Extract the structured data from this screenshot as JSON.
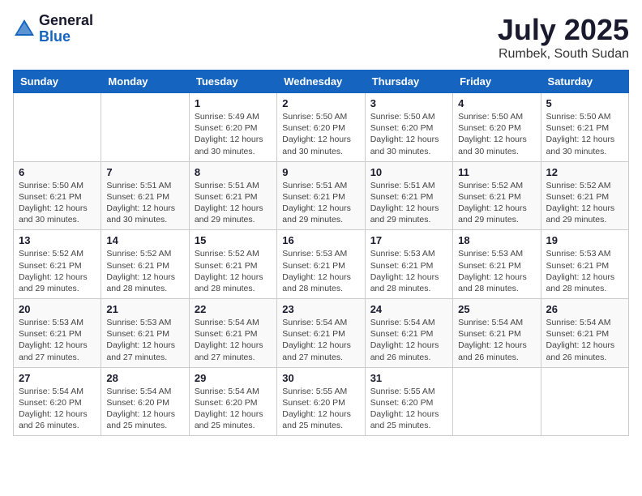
{
  "logo": {
    "general": "General",
    "blue": "Blue"
  },
  "title": {
    "month_year": "July 2025",
    "location": "Rumbek, South Sudan"
  },
  "columns": [
    "Sunday",
    "Monday",
    "Tuesday",
    "Wednesday",
    "Thursday",
    "Friday",
    "Saturday"
  ],
  "weeks": [
    [
      {
        "day": "",
        "info": ""
      },
      {
        "day": "",
        "info": ""
      },
      {
        "day": "1",
        "info": "Sunrise: 5:49 AM\nSunset: 6:20 PM\nDaylight: 12 hours and 30 minutes."
      },
      {
        "day": "2",
        "info": "Sunrise: 5:50 AM\nSunset: 6:20 PM\nDaylight: 12 hours and 30 minutes."
      },
      {
        "day": "3",
        "info": "Sunrise: 5:50 AM\nSunset: 6:20 PM\nDaylight: 12 hours and 30 minutes."
      },
      {
        "day": "4",
        "info": "Sunrise: 5:50 AM\nSunset: 6:20 PM\nDaylight: 12 hours and 30 minutes."
      },
      {
        "day": "5",
        "info": "Sunrise: 5:50 AM\nSunset: 6:21 PM\nDaylight: 12 hours and 30 minutes."
      }
    ],
    [
      {
        "day": "6",
        "info": "Sunrise: 5:50 AM\nSunset: 6:21 PM\nDaylight: 12 hours and 30 minutes."
      },
      {
        "day": "7",
        "info": "Sunrise: 5:51 AM\nSunset: 6:21 PM\nDaylight: 12 hours and 30 minutes."
      },
      {
        "day": "8",
        "info": "Sunrise: 5:51 AM\nSunset: 6:21 PM\nDaylight: 12 hours and 29 minutes."
      },
      {
        "day": "9",
        "info": "Sunrise: 5:51 AM\nSunset: 6:21 PM\nDaylight: 12 hours and 29 minutes."
      },
      {
        "day": "10",
        "info": "Sunrise: 5:51 AM\nSunset: 6:21 PM\nDaylight: 12 hours and 29 minutes."
      },
      {
        "day": "11",
        "info": "Sunrise: 5:52 AM\nSunset: 6:21 PM\nDaylight: 12 hours and 29 minutes."
      },
      {
        "day": "12",
        "info": "Sunrise: 5:52 AM\nSunset: 6:21 PM\nDaylight: 12 hours and 29 minutes."
      }
    ],
    [
      {
        "day": "13",
        "info": "Sunrise: 5:52 AM\nSunset: 6:21 PM\nDaylight: 12 hours and 29 minutes."
      },
      {
        "day": "14",
        "info": "Sunrise: 5:52 AM\nSunset: 6:21 PM\nDaylight: 12 hours and 28 minutes."
      },
      {
        "day": "15",
        "info": "Sunrise: 5:52 AM\nSunset: 6:21 PM\nDaylight: 12 hours and 28 minutes."
      },
      {
        "day": "16",
        "info": "Sunrise: 5:53 AM\nSunset: 6:21 PM\nDaylight: 12 hours and 28 minutes."
      },
      {
        "day": "17",
        "info": "Sunrise: 5:53 AM\nSunset: 6:21 PM\nDaylight: 12 hours and 28 minutes."
      },
      {
        "day": "18",
        "info": "Sunrise: 5:53 AM\nSunset: 6:21 PM\nDaylight: 12 hours and 28 minutes."
      },
      {
        "day": "19",
        "info": "Sunrise: 5:53 AM\nSunset: 6:21 PM\nDaylight: 12 hours and 28 minutes."
      }
    ],
    [
      {
        "day": "20",
        "info": "Sunrise: 5:53 AM\nSunset: 6:21 PM\nDaylight: 12 hours and 27 minutes."
      },
      {
        "day": "21",
        "info": "Sunrise: 5:53 AM\nSunset: 6:21 PM\nDaylight: 12 hours and 27 minutes."
      },
      {
        "day": "22",
        "info": "Sunrise: 5:54 AM\nSunset: 6:21 PM\nDaylight: 12 hours and 27 minutes."
      },
      {
        "day": "23",
        "info": "Sunrise: 5:54 AM\nSunset: 6:21 PM\nDaylight: 12 hours and 27 minutes."
      },
      {
        "day": "24",
        "info": "Sunrise: 5:54 AM\nSunset: 6:21 PM\nDaylight: 12 hours and 26 minutes."
      },
      {
        "day": "25",
        "info": "Sunrise: 5:54 AM\nSunset: 6:21 PM\nDaylight: 12 hours and 26 minutes."
      },
      {
        "day": "26",
        "info": "Sunrise: 5:54 AM\nSunset: 6:21 PM\nDaylight: 12 hours and 26 minutes."
      }
    ],
    [
      {
        "day": "27",
        "info": "Sunrise: 5:54 AM\nSunset: 6:20 PM\nDaylight: 12 hours and 26 minutes."
      },
      {
        "day": "28",
        "info": "Sunrise: 5:54 AM\nSunset: 6:20 PM\nDaylight: 12 hours and 25 minutes."
      },
      {
        "day": "29",
        "info": "Sunrise: 5:54 AM\nSunset: 6:20 PM\nDaylight: 12 hours and 25 minutes."
      },
      {
        "day": "30",
        "info": "Sunrise: 5:55 AM\nSunset: 6:20 PM\nDaylight: 12 hours and 25 minutes."
      },
      {
        "day": "31",
        "info": "Sunrise: 5:55 AM\nSunset: 6:20 PM\nDaylight: 12 hours and 25 minutes."
      },
      {
        "day": "",
        "info": ""
      },
      {
        "day": "",
        "info": ""
      }
    ]
  ]
}
